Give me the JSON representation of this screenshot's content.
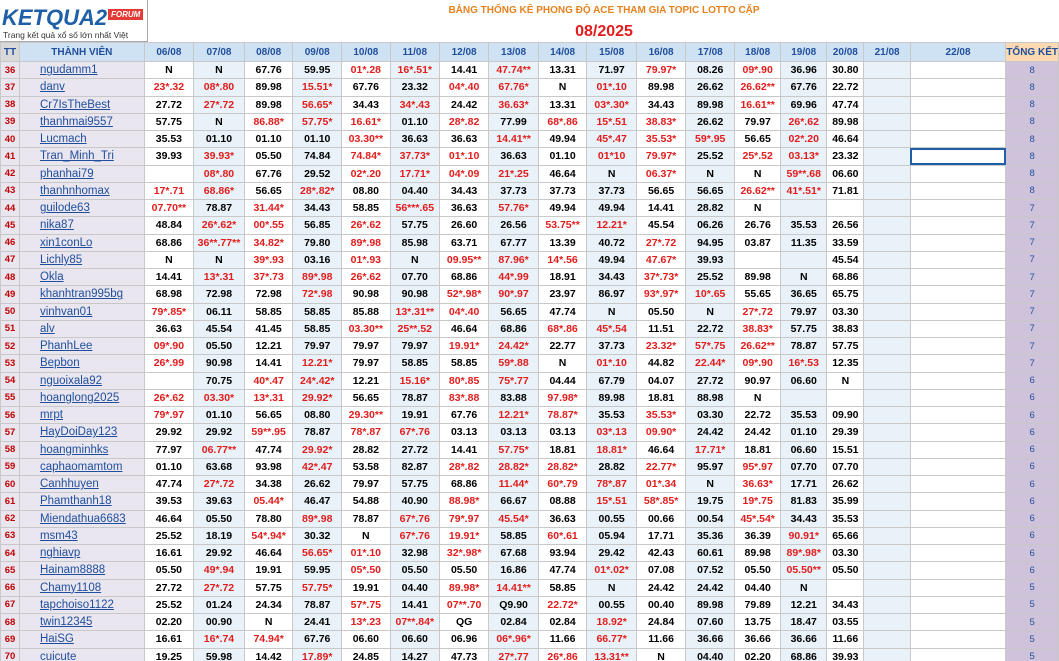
{
  "header": {
    "logo_text": "KETQUA2",
    "logo_forum": "FORUM",
    "logo_tagline": "Trang kết quả xổ số lớn nhất Việt Nam",
    "title": "BẢNG THỐNG KÊ PHONG ĐỘ ACE THAM GIA TOPIC  LOTTO CẶP",
    "month": "08/2025"
  },
  "columns": {
    "tt": "TT",
    "member": "THÀNH VIÊN",
    "dates": [
      "06/08",
      "07/08",
      "08/08",
      "09/08",
      "10/08",
      "11/08",
      "12/08",
      "13/08",
      "14/08",
      "15/08",
      "16/08",
      "17/08",
      "18/08",
      "19/08",
      "20/08",
      "21/08",
      "22/08"
    ],
    "total": "TỔNG KẾT"
  },
  "rows": [
    {
      "tt": "36",
      "name": "ngudamm1",
      "vals": [
        "N",
        "N",
        "67.76",
        "59.95",
        "01*.28",
        "16*.51*",
        "14.41",
        "47.74**",
        "13.31",
        "71.97",
        "79.97*",
        "08.26",
        "09*.90",
        "36.96",
        "30.80"
      ],
      "hits": [
        0,
        0,
        0,
        0,
        1,
        1,
        0,
        1,
        0,
        0,
        1,
        0,
        1,
        0,
        0
      ],
      "total": "8"
    },
    {
      "tt": "37",
      "name": "danv",
      "vals": [
        "23*.32",
        "08*.80",
        "89.98",
        "15.51*",
        "67.76",
        "23.32",
        "04*.40",
        "67.76*",
        "N",
        "01*.10",
        "89.98",
        "26.62",
        "26.62**",
        "67.76",
        "22.72"
      ],
      "hits": [
        1,
        1,
        0,
        1,
        0,
        0,
        1,
        1,
        0,
        1,
        0,
        0,
        1,
        0,
        0
      ],
      "total": "8"
    },
    {
      "tt": "38",
      "name": "Cr7IsTheBest",
      "vals": [
        "27.72",
        "27*.72",
        "89.98",
        "56.65*",
        "34.43",
        "34*.43",
        "24.42",
        "36.63*",
        "13.31",
        "03*.30*",
        "34.43",
        "89.98",
        "16.61**",
        "69.96",
        "47.74"
      ],
      "hits": [
        0,
        1,
        0,
        1,
        0,
        1,
        0,
        1,
        0,
        1,
        0,
        0,
        1,
        0,
        0
      ],
      "total": "8"
    },
    {
      "tt": "39",
      "name": "thanhmai9557",
      "vals": [
        "57.75",
        "N",
        "86.88*",
        "57.75*",
        "16.61*",
        "01.10",
        "28*.82",
        "77.99",
        "68*.86",
        "15*.51",
        "38.83*",
        "26.62",
        "79.97",
        "26*.62",
        "89.98"
      ],
      "hits": [
        0,
        0,
        1,
        1,
        1,
        0,
        1,
        0,
        1,
        1,
        1,
        0,
        0,
        1,
        0
      ],
      "total": "8"
    },
    {
      "tt": "40",
      "name": "Lucmach",
      "vals": [
        "35.53",
        "01.10",
        "01.10",
        "01.10",
        "03.30**",
        "36.63",
        "36.63",
        "14.41**",
        "49.94",
        "45*.47",
        "35.53*",
        "59*.95",
        "56.65",
        "02*.20",
        "46.64"
      ],
      "hits": [
        0,
        0,
        0,
        0,
        1,
        0,
        0,
        1,
        0,
        1,
        1,
        1,
        0,
        1,
        0
      ],
      "total": "8"
    },
    {
      "tt": "41",
      "name": "Tran_Minh_Tri",
      "vals": [
        "39.93",
        "39.93*",
        "05.50",
        "74.84",
        "74.84*",
        "37.73*",
        "01*.10",
        "36.63",
        "01.10",
        "01*10",
        "79.97*",
        "25.52",
        "25*.52",
        "03.13*",
        "23.32"
      ],
      "hits": [
        0,
        1,
        0,
        0,
        1,
        1,
        1,
        0,
        0,
        1,
        1,
        0,
        1,
        1,
        0
      ],
      "total": "8"
    },
    {
      "tt": "42",
      "name": "phanhai79",
      "vals": [
        "",
        "08*.80",
        "67.76",
        "29.52",
        "02*.20",
        "17.71*",
        "04*.09",
        "21*.25",
        "46.64",
        "N",
        "06.37*",
        "N",
        "N",
        "59**.68",
        "06.60"
      ],
      "hits": [
        0,
        1,
        0,
        0,
        1,
        1,
        1,
        1,
        0,
        0,
        1,
        0,
        0,
        1,
        0
      ],
      "total": "8"
    },
    {
      "tt": "43",
      "name": "thanhnhomax",
      "vals": [
        "17*.71",
        "68.86*",
        "56.65",
        "28*.82*",
        "08.80",
        "04.40",
        "34.43",
        "37.73",
        "37.73",
        "37.73",
        "56.65",
        "56.65",
        "26.62**",
        "41*.51*",
        "71.81"
      ],
      "hits": [
        1,
        1,
        0,
        1,
        0,
        0,
        0,
        0,
        0,
        0,
        0,
        0,
        1,
        1,
        0
      ],
      "total": "8"
    },
    {
      "tt": "44",
      "name": "guilode63",
      "vals": [
        "07.70**",
        "78.87",
        "31.44*",
        "34.43",
        "58.85",
        "56***.65",
        "36.63",
        "57.76*",
        "49.94",
        "49.94",
        "14.41",
        "28.82",
        "N",
        "",
        ""
      ],
      "hits": [
        1,
        0,
        1,
        0,
        0,
        1,
        0,
        1,
        0,
        0,
        0,
        0,
        0,
        0,
        0
      ],
      "total": "7"
    },
    {
      "tt": "45",
      "name": "nika87",
      "vals": [
        "48.84",
        "26*.62*",
        "00*.55",
        "56.85",
        "26*.62",
        "57.75",
        "26.60",
        "26.56",
        "53.75**",
        "12.21*",
        "45.54",
        "06.26",
        "26.76",
        "35.53",
        "26.56"
      ],
      "hits": [
        0,
        1,
        1,
        0,
        1,
        0,
        0,
        0,
        1,
        1,
        0,
        0,
        0,
        0,
        0
      ],
      "total": "7"
    },
    {
      "tt": "46",
      "name": "xin1conLo",
      "vals": [
        "68.86",
        "36**.77**",
        "34.82*",
        "79.80",
        "89*.98",
        "85.98",
        "63.71",
        "67.77",
        "13.39",
        "40.72",
        "27*.72",
        "94.95",
        "03.87",
        "11.35",
        "33.59"
      ],
      "hits": [
        0,
        1,
        1,
        0,
        1,
        0,
        0,
        0,
        0,
        0,
        1,
        0,
        0,
        0,
        0
      ],
      "total": "7"
    },
    {
      "tt": "47",
      "name": "Lichly85",
      "vals": [
        "N",
        "N",
        "39*.93",
        "03.16",
        "01*.93",
        "N",
        "09.95**",
        "87.96*",
        "14*.56",
        "49.94",
        "47.67*",
        "39.93",
        "",
        "",
        "45.54"
      ],
      "hits": [
        0,
        0,
        1,
        0,
        1,
        0,
        1,
        1,
        1,
        0,
        1,
        0,
        0,
        0,
        0
      ],
      "total": "7"
    },
    {
      "tt": "48",
      "name": "Okla",
      "vals": [
        "14.41",
        "13*.31",
        "37*.73",
        "89*.98",
        "26*.62",
        "07.70",
        "68.86",
        "44*.99",
        "18.91",
        "34.43",
        "37*.73*",
        "25.52",
        "89.98",
        "N",
        "68.86"
      ],
      "hits": [
        0,
        1,
        1,
        1,
        1,
        0,
        0,
        1,
        0,
        0,
        1,
        0,
        0,
        0,
        0
      ],
      "total": "7"
    },
    {
      "tt": "49",
      "name": "khanhtran995bg",
      "vals": [
        "68.98",
        "72.98",
        "72.98",
        "72*.98",
        "90.98",
        "90.98",
        "52*.98*",
        "90*.97",
        "23.97",
        "86.97",
        "93*.97*",
        "10*.65",
        "55.65",
        "36.65",
        "65.75"
      ],
      "hits": [
        0,
        0,
        0,
        1,
        0,
        0,
        1,
        1,
        0,
        0,
        1,
        1,
        0,
        0,
        0
      ],
      "total": "7"
    },
    {
      "tt": "50",
      "name": "vinhvan01",
      "vals": [
        "79*.85*",
        "06.11",
        "58.85",
        "58.85",
        "85.88",
        "13*.31**",
        "04*.40",
        "56.65",
        "47.74",
        "N",
        "05.50",
        "N",
        "27*.72",
        "79.97",
        "03.30"
      ],
      "hits": [
        1,
        0,
        0,
        0,
        0,
        1,
        1,
        0,
        0,
        0,
        0,
        0,
        1,
        0,
        0
      ],
      "total": "7"
    },
    {
      "tt": "51",
      "name": "alv",
      "vals": [
        "36.63",
        "45.54",
        "41.45",
        "58.85",
        "03.30**",
        "25**.52",
        "46.64",
        "68.86",
        "68*.86",
        "45*.54",
        "11.51",
        "22.72",
        "38.83*",
        "57.75",
        "38.83"
      ],
      "hits": [
        0,
        0,
        0,
        0,
        1,
        1,
        0,
        0,
        1,
        1,
        0,
        0,
        1,
        0,
        0
      ],
      "total": "7"
    },
    {
      "tt": "52",
      "name": "PhanhLee",
      "vals": [
        "09*.90",
        "05.50",
        "12.21",
        "79.97",
        "79.97",
        "79.97",
        "19.91*",
        "24.42*",
        "22.77",
        "37.73",
        "23.32*",
        "57*.75",
        "26.62**",
        "78.87",
        "57.75"
      ],
      "hits": [
        1,
        0,
        0,
        0,
        0,
        0,
        1,
        1,
        0,
        0,
        1,
        1,
        1,
        0,
        0
      ],
      "total": "7"
    },
    {
      "tt": "53",
      "name": "Bepbon",
      "vals": [
        "26*.99",
        "90.98",
        "14.41",
        "12.21*",
        "79.97",
        "58.85",
        "58.85",
        "59*.88",
        "N",
        "01*.10",
        "44.82",
        "22.44*",
        "09*.90",
        "16*.53",
        "12.35"
      ],
      "hits": [
        1,
        0,
        0,
        1,
        0,
        0,
        0,
        1,
        0,
        1,
        0,
        1,
        1,
        1,
        0
      ],
      "total": "7"
    },
    {
      "tt": "54",
      "name": "nguoixala92",
      "vals": [
        "",
        "70.75",
        "40*.47",
        "24*.42*",
        "12.21",
        "15.16*",
        "80*.85",
        "75*.77",
        "04.44",
        "67.79",
        "04.07",
        "27.72",
        "90.97",
        "06.60",
        "N"
      ],
      "hits": [
        0,
        0,
        1,
        1,
        0,
        1,
        1,
        1,
        0,
        0,
        0,
        0,
        0,
        0,
        0
      ],
      "total": "6"
    },
    {
      "tt": "55",
      "name": "hoanglong2025",
      "vals": [
        "26*.62",
        "03.30*",
        "13*.31",
        "29.92*",
        "56.65",
        "78.87",
        "83*.88",
        "83.88",
        "97.98*",
        "89.98",
        "18.81",
        "88.98",
        "N",
        "",
        ""
      ],
      "hits": [
        1,
        1,
        1,
        1,
        0,
        0,
        1,
        0,
        1,
        0,
        0,
        0,
        0,
        0,
        0
      ],
      "total": "6"
    },
    {
      "tt": "56",
      "name": "mrpt",
      "vals": [
        "79*.97",
        "01.10",
        "56.65",
        "08.80",
        "29.30**",
        "19.91",
        "67.76",
        "12.21*",
        "78.87*",
        "35.53",
        "35.53*",
        "03.30",
        "22.72",
        "35.53",
        "09.90"
      ],
      "hits": [
        1,
        0,
        0,
        0,
        1,
        0,
        0,
        1,
        1,
        0,
        1,
        0,
        0,
        0,
        0
      ],
      "total": "6"
    },
    {
      "tt": "57",
      "name": "HayDoiDay123",
      "vals": [
        "29.92",
        "29.92",
        "59**.95",
        "78.87",
        "78*.87",
        "67*.76",
        "03.13",
        "03.13",
        "03.13",
        "03*.13",
        "09.90*",
        "24.42",
        "24.42",
        "01.10",
        "29.39"
      ],
      "hits": [
        0,
        0,
        1,
        0,
        1,
        1,
        0,
        0,
        0,
        1,
        1,
        0,
        0,
        0,
        0
      ],
      "total": "6"
    },
    {
      "tt": "58",
      "name": "hoangminhks",
      "vals": [
        "77.97",
        "06.77**",
        "47.74",
        "29.92*",
        "28.82",
        "27.72",
        "14.41",
        "57.75*",
        "18.81",
        "18.81*",
        "46.64",
        "17.71*",
        "18.81",
        "06.60",
        "15.51"
      ],
      "hits": [
        0,
        1,
        0,
        1,
        0,
        0,
        0,
        1,
        0,
        1,
        0,
        1,
        0,
        0,
        0
      ],
      "total": "6"
    },
    {
      "tt": "59",
      "name": "caphaomamtom",
      "vals": [
        "01.10",
        "63.68",
        "93.98",
        "42*.47",
        "53.58",
        "82.87",
        "28*.82",
        "28.82*",
        "28.82*",
        "28.82",
        "22.77*",
        "95.97",
        "95*.97",
        "07.70",
        "07.70"
      ],
      "hits": [
        0,
        0,
        0,
        1,
        0,
        0,
        1,
        1,
        1,
        0,
        1,
        0,
        1,
        0,
        0
      ],
      "total": "6"
    },
    {
      "tt": "60",
      "name": "Canhhuyen",
      "vals": [
        "47.74",
        "27*.72",
        "34.38",
        "26.62",
        "79.97",
        "57.75",
        "68.86",
        "11.44*",
        "60*.79",
        "78*.87",
        "01*.34",
        "N",
        "36.63*",
        "17.71",
        "26.62"
      ],
      "hits": [
        0,
        1,
        0,
        0,
        0,
        0,
        0,
        1,
        1,
        1,
        1,
        0,
        1,
        0,
        0
      ],
      "total": "6"
    },
    {
      "tt": "61",
      "name": "Phamthanh18",
      "vals": [
        "39.53",
        "39.63",
        "05.44*",
        "46.47",
        "54.88",
        "40.90",
        "88.98*",
        "66.67",
        "08.88",
        "15*.51",
        "58*.85*",
        "19.75",
        "19*.75",
        "81.83",
        "35.99"
      ],
      "hits": [
        0,
        0,
        1,
        0,
        0,
        0,
        1,
        0,
        0,
        1,
        1,
        0,
        1,
        0,
        0
      ],
      "total": "6"
    },
    {
      "tt": "62",
      "name": "Miendathua6683",
      "vals": [
        "46.64",
        "05.50",
        "78.80",
        "89*.98",
        "78.87",
        "67*.76",
        "79*.97",
        "45.54*",
        "36.63",
        "00.55",
        "00.66",
        "00.54",
        "45*.54*",
        "34.43",
        "35.53"
      ],
      "hits": [
        0,
        0,
        0,
        1,
        0,
        1,
        1,
        1,
        0,
        0,
        0,
        0,
        1,
        0,
        0
      ],
      "total": "6"
    },
    {
      "tt": "63",
      "name": "msm43",
      "vals": [
        "25.52",
        "18.19",
        "54*.94*",
        "30.32",
        "N",
        "67*.76",
        "19.91*",
        "58.85",
        "60*.61",
        "05.94",
        "17.71",
        "35.36",
        "36.39",
        "90.91*",
        "65.66"
      ],
      "hits": [
        0,
        0,
        1,
        0,
        0,
        1,
        1,
        0,
        1,
        0,
        0,
        0,
        0,
        1,
        0
      ],
      "total": "6"
    },
    {
      "tt": "64",
      "name": "nghiavp",
      "vals": [
        "16.61",
        "29.92",
        "46.64",
        "56.65*",
        "01*.10",
        "32.98",
        "32*.98*",
        "67.68",
        "93.94",
        "29.42",
        "42.43",
        "60.61",
        "89.98",
        "89*.98*",
        "03.30"
      ],
      "hits": [
        0,
        0,
        0,
        1,
        1,
        0,
        1,
        0,
        0,
        0,
        0,
        0,
        0,
        1,
        0
      ],
      "total": "6"
    },
    {
      "tt": "65",
      "name": "Hainam8888",
      "vals": [
        "05.50",
        "49*.94",
        "19.91",
        "59.95",
        "05*.50",
        "05.50",
        "05.50",
        "16.86",
        "47.74",
        "01*.02*",
        "07.08",
        "07.52",
        "05.50",
        "05.50**",
        "05.50"
      ],
      "hits": [
        0,
        1,
        0,
        0,
        1,
        0,
        0,
        0,
        0,
        1,
        0,
        0,
        0,
        1,
        0
      ],
      "total": "6"
    },
    {
      "tt": "66",
      "name": "Chamy1108",
      "vals": [
        "27.72",
        "27*.72",
        "57.75",
        "57.75*",
        "19.91",
        "04.40",
        "89.98*",
        "14.41**",
        "58.85",
        "N",
        "24.42",
        "24.42",
        "04.40",
        "N",
        ""
      ],
      "hits": [
        0,
        1,
        0,
        1,
        0,
        0,
        1,
        1,
        0,
        0,
        0,
        0,
        0,
        0,
        0
      ],
      "total": "5"
    },
    {
      "tt": "67",
      "name": "tapchoiso1122",
      "vals": [
        "25.52",
        "01.24",
        "24.34",
        "78.87",
        "57*.75",
        "14.41",
        "07**.70",
        "Q9.90",
        "22.72*",
        "00.55",
        "00.40",
        "89.98",
        "79.89",
        "12.21",
        "34.43"
      ],
      "hits": [
        0,
        0,
        0,
        0,
        1,
        0,
        1,
        0,
        1,
        0,
        0,
        0,
        0,
        0,
        0
      ],
      "total": "5"
    },
    {
      "tt": "68",
      "name": "twin12345",
      "vals": [
        "02.20",
        "00.90",
        "N",
        "24.41",
        "13*.23",
        "07**.84*",
        "QG",
        "02.84",
        "02.84",
        "18.92*",
        "24.84",
        "07.60",
        "13.75",
        "18.47",
        "03.55"
      ],
      "hits": [
        0,
        0,
        0,
        0,
        1,
        1,
        0,
        0,
        0,
        1,
        0,
        0,
        0,
        0,
        0
      ],
      "total": "5"
    },
    {
      "tt": "69",
      "name": "HaiSG",
      "vals": [
        "16.61",
        "16*.74",
        "74.94*",
        "67.76",
        "06.60",
        "06.60",
        "06.96",
        "06*.96*",
        "11.66",
        "66.77*",
        "11.66",
        "36.66",
        "36.66",
        "36.66",
        "11.66"
      ],
      "hits": [
        0,
        1,
        1,
        0,
        0,
        0,
        0,
        1,
        0,
        1,
        0,
        0,
        0,
        0,
        0
      ],
      "total": "5"
    },
    {
      "tt": "70",
      "name": "cuicute",
      "vals": [
        "19.25",
        "59.98",
        "14.42",
        "17.89*",
        "24.85",
        "14.27",
        "47.73",
        "27*.77",
        "26*.86",
        "13.31**",
        "N",
        "04.40",
        "02.20",
        "68.86",
        "39.93"
      ],
      "hits": [
        0,
        0,
        0,
        1,
        0,
        0,
        0,
        1,
        1,
        1,
        0,
        0,
        0,
        0,
        0
      ],
      "total": "5"
    }
  ]
}
